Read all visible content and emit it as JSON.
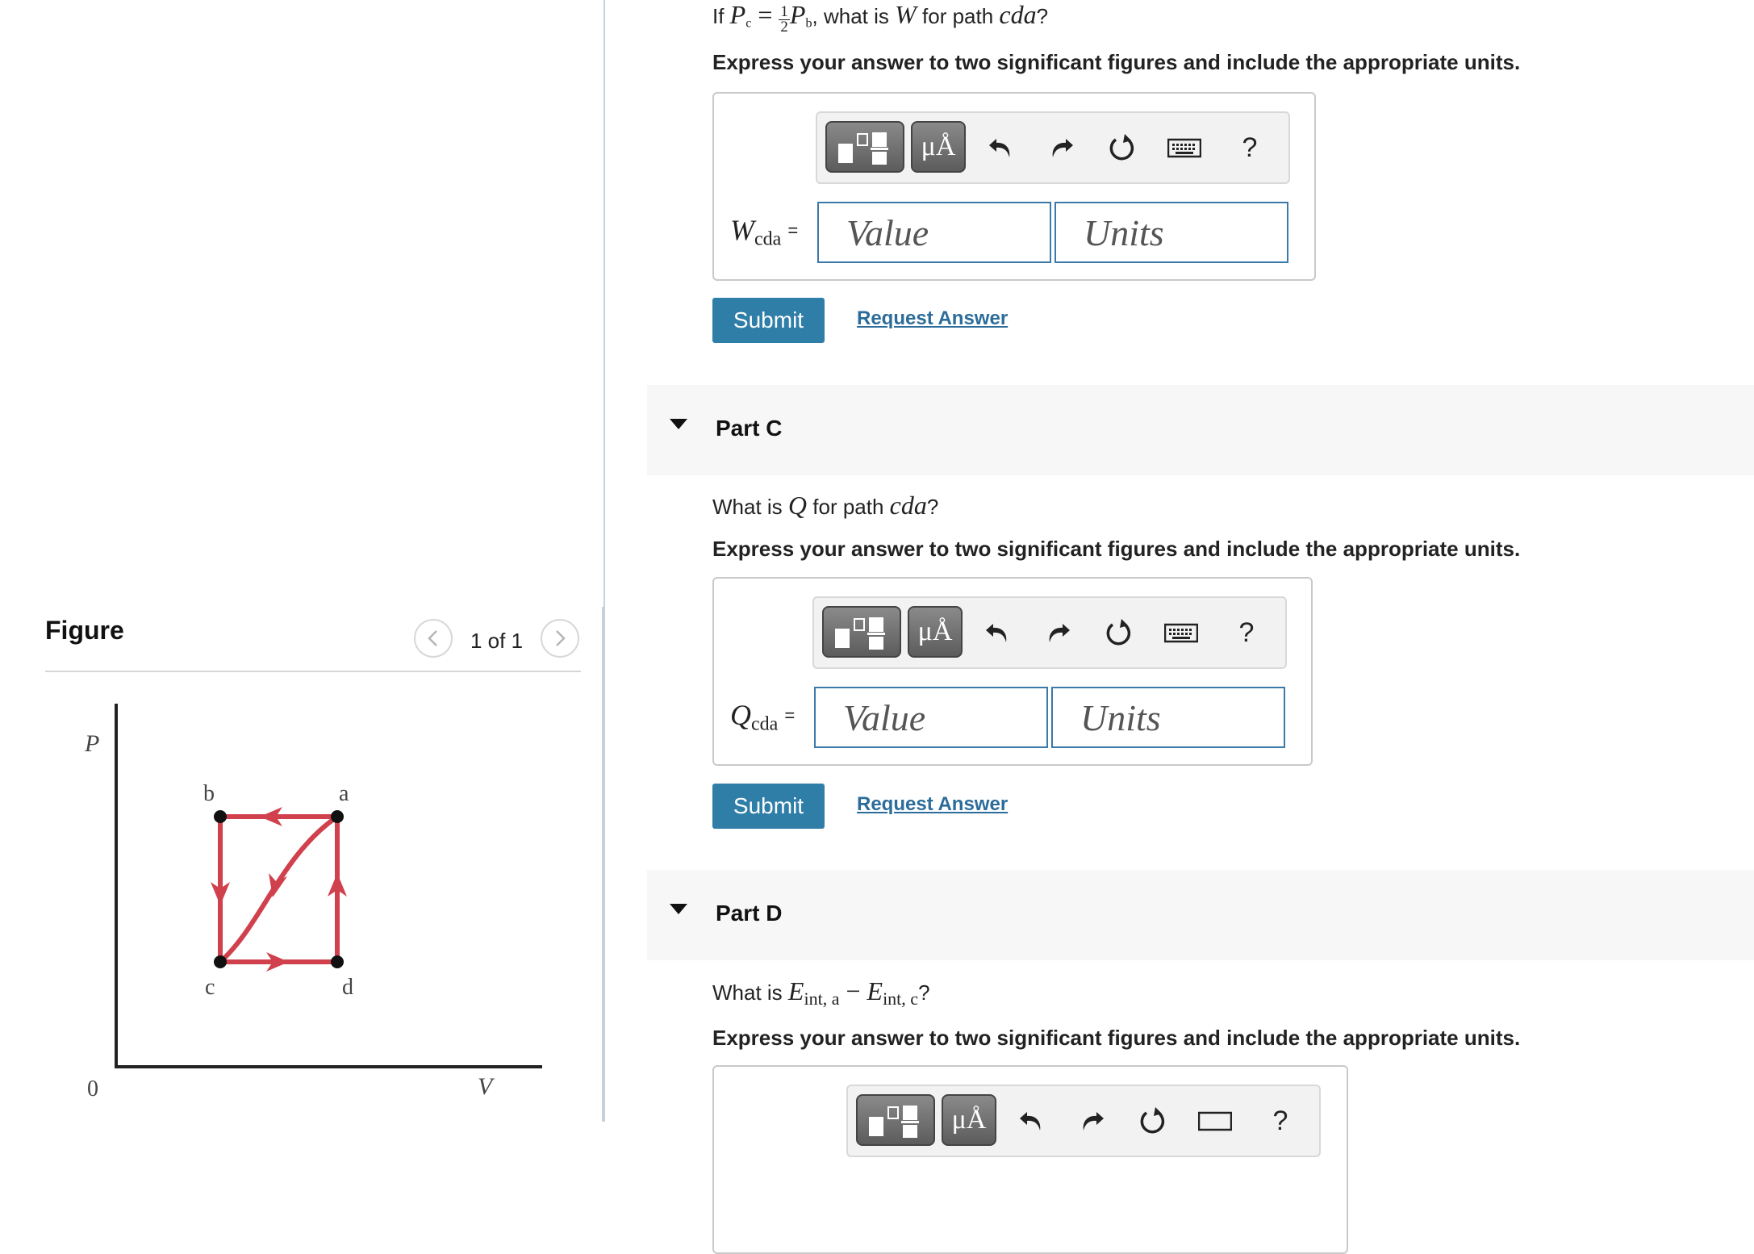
{
  "figure_panel": {
    "title": "Figure",
    "counter": "1 of 1",
    "diagram": {
      "axis_y_label": "P",
      "axis_x_label": "V",
      "origin_label": "0",
      "points": [
        "a",
        "b",
        "c",
        "d"
      ]
    }
  },
  "part_b": {
    "q_prefix": "If ",
    "q_P": "P",
    "q_sub_c": "c",
    "q_equals": " = ",
    "q_frac_num": "1",
    "q_frac_den": "2",
    "q_sub_b": "b",
    "q_mid": ", what is ",
    "q_W": "W",
    "q_for": " for path ",
    "q_path": "cda",
    "q_end": "?",
    "instruction": "Express your answer to two significant figures and include the appropriate units.",
    "answer_symbol": "W",
    "answer_sub": "cda",
    "equals": "=",
    "value_placeholder": "Value",
    "units_placeholder": "Units",
    "submit_label": "Submit",
    "request_label": "Request Answer"
  },
  "part_c": {
    "title": "Part C",
    "q_prefix": "What is ",
    "q_Q": "Q",
    "q_for": " for path ",
    "q_path": "cda",
    "q_end": "?",
    "instruction": "Express your answer to two significant figures and include the appropriate units.",
    "answer_symbol": "Q",
    "answer_sub": "cda",
    "equals": "=",
    "value_placeholder": "Value",
    "units_placeholder": "Units",
    "submit_label": "Submit",
    "request_label": "Request Answer"
  },
  "part_d": {
    "title": "Part D",
    "q_prefix": "What is ",
    "q_E1": "E",
    "q_sub1": "int, a",
    "q_minus": " − ",
    "q_E2": "E",
    "q_sub2": "int, c",
    "q_end": "?",
    "instruction": "Express your answer to two significant figures and include the appropriate units."
  },
  "toolbar": {
    "units_label": "μÅ",
    "help_label": "?",
    "icons": [
      "templates-icon",
      "units-icon",
      "undo-icon",
      "redo-icon",
      "reset-icon",
      "keyboard-icon",
      "help-icon"
    ]
  },
  "colors": {
    "accent": "#2f7ea8",
    "link": "#2b6c9a",
    "input_border": "#3a79a8",
    "diagram_path": "#d0414d",
    "part_bar": "#f7f7f7"
  }
}
